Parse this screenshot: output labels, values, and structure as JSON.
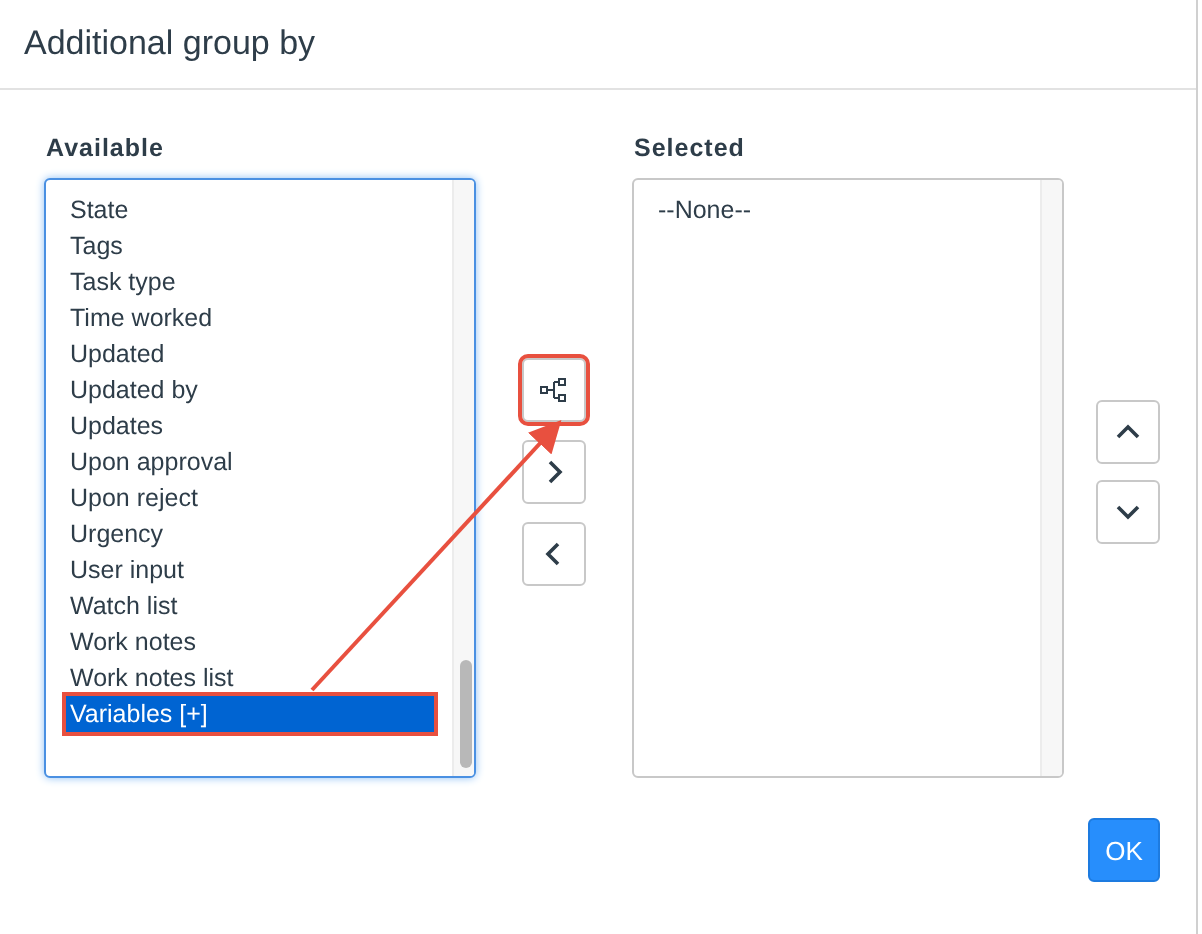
{
  "dialog": {
    "title": "Additional group by"
  },
  "available": {
    "label": "Available",
    "items": [
      {
        "text": "State",
        "selected": false
      },
      {
        "text": "Tags",
        "selected": false
      },
      {
        "text": "Task type",
        "selected": false
      },
      {
        "text": "Time worked",
        "selected": false
      },
      {
        "text": "Updated",
        "selected": false
      },
      {
        "text": "Updated by",
        "selected": false
      },
      {
        "text": "Updates",
        "selected": false
      },
      {
        "text": "Upon approval",
        "selected": false
      },
      {
        "text": "Upon reject",
        "selected": false
      },
      {
        "text": "Urgency",
        "selected": false
      },
      {
        "text": "User input",
        "selected": false
      },
      {
        "text": "Watch list",
        "selected": false
      },
      {
        "text": "Work notes",
        "selected": false
      },
      {
        "text": "Work notes list",
        "selected": false
      },
      {
        "text": "Variables [+]",
        "selected": true
      }
    ]
  },
  "selected_list": {
    "label": "Selected",
    "items": [
      {
        "text": "--None--",
        "selected": false
      }
    ]
  },
  "buttons": {
    "ok": "OK"
  }
}
